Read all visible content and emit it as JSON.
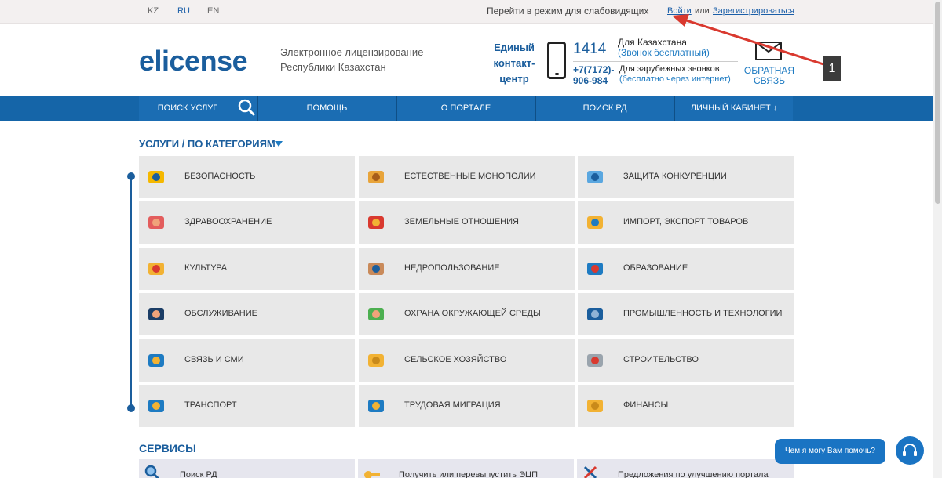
{
  "topbar": {
    "languages": [
      "KZ",
      "RU",
      "EN"
    ],
    "active_language": "RU",
    "low_vision": "Перейти в режим для слабовидящих",
    "login": "Войти",
    "or": "или",
    "register": "Зарегистрироваться"
  },
  "header": {
    "logo": "elicense",
    "tagline_line1": "Электронное лицензирование",
    "tagline_line2": "Республики Казахстан",
    "contact_center_line1": "Единый",
    "contact_center_line2": "контакт-",
    "contact_center_line3": "центр",
    "short_number": "1414",
    "kz_label": "Для Казахстана",
    "kz_free": "(Звонок бесплатный)",
    "long_number_line1": "+7(7172)-",
    "long_number_line2": "906-984",
    "intl_label": "Для зарубежных звонков",
    "intl_free": "(бесплатно через интернет)",
    "feedback_line1": "ОБРАТНАЯ",
    "feedback_line2": "СВЯЗЬ"
  },
  "annotation": {
    "badge": "1"
  },
  "nav": {
    "items": [
      "ПОИСК УСЛУГ",
      "ПОМОЩЬ",
      "О ПОРТАЛЕ",
      "ПОИСК РД",
      "ЛИЧНЫЙ КАБИНЕТ ↓"
    ]
  },
  "categories": {
    "title": "УСЛУГИ / ПО КАТЕГОРИЯМ",
    "tiles": [
      [
        "БЕЗОПАСНОСТЬ",
        "ЕСТЕСТВЕННЫЕ МОНОПОЛИИ",
        "ЗАЩИТА КОНКУРЕНЦИИ"
      ],
      [
        "ЗДРАВООХРАНЕНИЕ",
        "ЗЕМЕЛЬНЫЕ ОТНОШЕНИЯ",
        "ИМПОРТ, ЭКСПОРТ ТОВАРОВ"
      ],
      [
        "КУЛЬТУРА",
        "НЕДРОПОЛЬЗОВАНИЕ",
        "ОБРАЗОВАНИЕ"
      ],
      [
        "ОБСЛУЖИВАНИЕ",
        "ОХРАНА ОКРУЖАЮЩЕЙ СРЕДЫ",
        "ПРОМЫШЛЕННОСТЬ И ТЕХНОЛОГИИ"
      ],
      [
        "СВЯЗЬ И СМИ",
        "СЕЛЬСКОЕ ХОЗЯЙСТВО",
        "СТРОИТЕЛЬСТВО"
      ],
      [
        "ТРАНСПОРТ",
        "ТРУДОВАЯ МИГРАЦИЯ",
        "ФИНАНСЫ"
      ]
    ],
    "icons": [
      [
        "shield-lock-icon",
        "briefcase-icon",
        "copyright-icon"
      ],
      [
        "medical-cross-icon",
        "house-icon",
        "document-list-icon"
      ],
      [
        "theater-masks-icon",
        "shovel-icon",
        "books-icon"
      ],
      [
        "handshake-icon",
        "plant-hand-icon",
        "factory-icon"
      ],
      [
        "telephone-icon",
        "wheat-icon",
        "trowel-icon"
      ],
      [
        "truck-icon",
        "passport-icon",
        "coin-icon"
      ]
    ]
  },
  "services": {
    "title": "СЕРВИСЫ",
    "items": [
      "Поиск РД",
      "Получить или перевыпустить ЭЦП",
      "Предложения по улучшению портала"
    ]
  },
  "chat": {
    "label": "Чем я могу Вам помочь?"
  },
  "colors": {
    "brand": "#1b5e9d",
    "nav": "#1b6db3",
    "tile": "#e8e8e8",
    "accent": "#1e7bc2",
    "annotation_arrow": "#d9392f"
  }
}
